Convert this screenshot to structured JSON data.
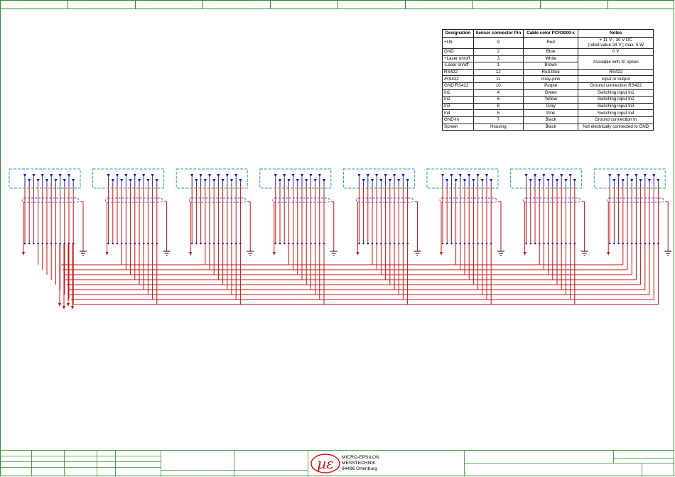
{
  "table": {
    "headers": [
      "Designation",
      "Sensor connector Pin",
      "Cable color PCR3000-x",
      "Notes"
    ],
    "rows": [
      {
        "designation": "+Ub",
        "pin": "9",
        "color": "Red",
        "note_lines": [
          "+ 11 V - 30 V DC",
          "(rated value 24 V); max. 5 W"
        ]
      },
      {
        "designation": "GND",
        "pin": "2",
        "color": "Blue",
        "note_lines": [
          "0 V"
        ]
      },
      {
        "designation": "+Laser on/off",
        "pin": "3",
        "color": "White",
        "note_lines": [
          "Available with SI option"
        ]
      },
      {
        "designation": "-Laser on/off",
        "pin": "1",
        "color": "Brown",
        "note_lines": []
      },
      {
        "designation": "RS422",
        "pin": "12",
        "color": "Red-blue",
        "note_lines": [
          "RS422"
        ]
      },
      {
        "designation": "/RS422",
        "pin": "11",
        "color": "Gray-pink",
        "note_lines": [
          "input or output"
        ]
      },
      {
        "designation": "GND RS422",
        "pin": "10",
        "color": "Purple",
        "note_lines": [
          "Ground connection RS422"
        ]
      },
      {
        "designation": "In1",
        "pin": "4",
        "color": "Green",
        "note_lines": [
          "Switching input In1"
        ]
      },
      {
        "designation": "In2",
        "pin": "6",
        "color": "Yellow",
        "note_lines": [
          "Switching input In2"
        ]
      },
      {
        "designation": "In3",
        "pin": "8",
        "color": "Gray",
        "note_lines": [
          "Switching input In3"
        ]
      },
      {
        "designation": "In4",
        "pin": "5",
        "color": "Pink",
        "note_lines": [
          "Switching input In4"
        ]
      },
      {
        "designation": "GND-In",
        "pin": "7",
        "color": "Black",
        "note_lines": [
          "Ground connection In"
        ]
      },
      {
        "designation": "Screen",
        "pin": "Housing",
        "color": "Black",
        "note_lines": [
          "Not electrically connected to GND"
        ]
      }
    ]
  },
  "title_block": {
    "company_lines": [
      "MICRO-EPSILON",
      "MESSTECHNIK",
      "94496 Ortenburg"
    ],
    "logo": "µε"
  },
  "diagram": {
    "sensor_count": 8,
    "pins_per_sensor": 12,
    "colors": {
      "frame": "#2e8b2e",
      "sensor_box": "#2aa0a0",
      "wire": "#cc1111",
      "terminal": "#1a1acc",
      "logo": "#cc1111"
    }
  }
}
